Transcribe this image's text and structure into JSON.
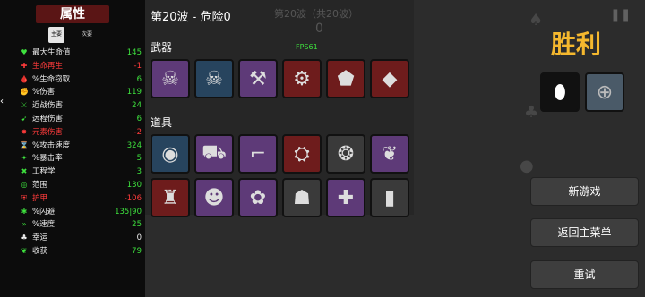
{
  "stats": {
    "title": "属性",
    "tabs": [
      "主要",
      "次要"
    ],
    "rows": [
      {
        "icon": "♥",
        "label": "最大生命值",
        "value": "145",
        "label_color": "wht",
        "value_color": "green",
        "icon_name": "heart-icon"
      },
      {
        "icon": "✚",
        "label": "生命再生",
        "value": "-1",
        "label_color": "red",
        "value_color": "red",
        "icon_name": "regen-icon"
      },
      {
        "icon": "🩸",
        "label": "%生命窃取",
        "value": "6",
        "label_color": "wht",
        "value_color": "green",
        "icon_name": "lifesteal-icon"
      },
      {
        "icon": "✊",
        "label": "%伤害",
        "value": "119",
        "label_color": "wht",
        "value_color": "green",
        "icon_name": "damage-icon"
      },
      {
        "icon": "⚔",
        "label": "近战伤害",
        "value": "24",
        "label_color": "wht",
        "value_color": "green",
        "icon_name": "melee-icon"
      },
      {
        "icon": "➹",
        "label": "远程伤害",
        "value": "6",
        "label_color": "wht",
        "value_color": "green",
        "icon_name": "ranged-icon"
      },
      {
        "icon": "✸",
        "label": "元素伤害",
        "value": "-2",
        "label_color": "red",
        "value_color": "red",
        "icon_name": "elemental-icon"
      },
      {
        "icon": "⌛",
        "label": "%攻击速度",
        "value": "324",
        "label_color": "wht",
        "value_color": "green",
        "icon_name": "attack-speed-icon"
      },
      {
        "icon": "✦",
        "label": "%暴击率",
        "value": "5",
        "label_color": "wht",
        "value_color": "green",
        "icon_name": "crit-icon"
      },
      {
        "icon": "✖",
        "label": "工程学",
        "value": "3",
        "label_color": "wht",
        "value_color": "green",
        "icon_name": "engineering-icon"
      },
      {
        "icon": "◎",
        "label": "范围",
        "value": "130",
        "label_color": "wht",
        "value_color": "green",
        "icon_name": "range-icon"
      },
      {
        "icon": "⛨",
        "label": "护甲",
        "value": "-106",
        "label_color": "red",
        "value_color": "red",
        "icon_name": "armor-icon"
      },
      {
        "icon": "✱",
        "label": "%闪避",
        "value": "135|90",
        "label_color": "wht",
        "value_color": "green",
        "icon_name": "dodge-icon"
      },
      {
        "icon": "»",
        "label": "%速度",
        "value": "25",
        "label_color": "wht",
        "value_color": "green",
        "icon_name": "speed-icon"
      },
      {
        "icon": "♣",
        "label": "幸运",
        "value": "0",
        "label_color": "wht",
        "value_color": "wht",
        "icon_name": "luck-icon"
      },
      {
        "icon": "❦",
        "label": "收获",
        "value": "79",
        "label_color": "wht",
        "value_color": "green",
        "icon_name": "harvest-icon"
      }
    ]
  },
  "header": {
    "wave_title": "第20波 - 危险0",
    "faint_wave": "第20波（共20波）",
    "faint_count": "0",
    "fps": "FPS61"
  },
  "weapons": {
    "title": "武器",
    "items": [
      {
        "name": "skull-mace-icon",
        "glyph": "☠",
        "bg": "purple"
      },
      {
        "name": "skull-mace-icon",
        "glyph": "☠",
        "bg": "blue"
      },
      {
        "name": "axe-icon",
        "glyph": "⚒",
        "bg": "purple"
      },
      {
        "name": "saw-blade-icon",
        "glyph": "⚙",
        "bg": "redbg"
      },
      {
        "name": "rock-icon",
        "glyph": "⬟",
        "bg": "redbg"
      },
      {
        "name": "shard-icon",
        "glyph": "◆",
        "bg": "redbg"
      }
    ]
  },
  "items": {
    "title": "道具",
    "row1": [
      {
        "name": "ring-icon",
        "glyph": "◉",
        "bg": "blue"
      },
      {
        "name": "tractor-icon",
        "glyph": "⛟",
        "bg": "purple"
      },
      {
        "name": "cannon-icon",
        "glyph": "⌐",
        "bg": "purple"
      },
      {
        "name": "alien-icon",
        "glyph": "⛭",
        "bg": "redbg"
      },
      {
        "name": "red-blob-icon",
        "glyph": "❂",
        "bg": "gray"
      },
      {
        "name": "claws-icon",
        "glyph": "❦",
        "bg": "purple"
      }
    ],
    "row2": [
      {
        "name": "red-cloak-icon",
        "glyph": "♜",
        "bg": "redbg"
      },
      {
        "name": "ninja-icon",
        "glyph": "☻",
        "bg": "purple"
      },
      {
        "name": "pink-creature-icon",
        "glyph": "✿",
        "bg": "purple"
      },
      {
        "name": "fossil-icon",
        "glyph": "☗",
        "bg": "gray"
      },
      {
        "name": "bone-icon",
        "glyph": "✚",
        "bg": "purple"
      },
      {
        "name": "tombstone-icon",
        "glyph": "▮",
        "bg": "gray"
      }
    ]
  },
  "victory": {
    "text": "胜利",
    "character": {
      "name": "egg-character-icon",
      "glyph": "⬮"
    },
    "trap": {
      "name": "bear-trap-icon",
      "glyph": "⊕"
    }
  },
  "buttons": {
    "new_game": "新游戏",
    "main_menu": "返回主菜单",
    "retry": "重试"
  },
  "colors": {
    "accent": "#f5b82e",
    "positive": "#3ee23e",
    "negative": "#ff3b3b"
  }
}
